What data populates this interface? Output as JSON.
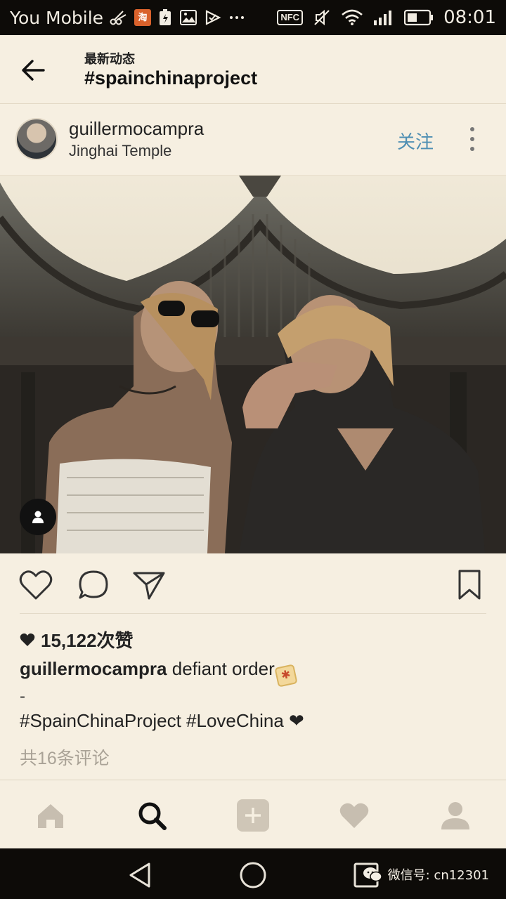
{
  "status_bar": {
    "carrier": "You Mobile",
    "nfc": "NFC",
    "tao_icon_label": "淘",
    "time": "08:01"
  },
  "header": {
    "subtitle": "最新动态",
    "title": "#spainchinaproject"
  },
  "post": {
    "username": "guillermocampra",
    "location": "Jinghai Temple",
    "follow_label": "关注",
    "likes": "15,122次赞",
    "caption_user": "guillermocampra",
    "caption_text": "defiant order",
    "caption_dash": "-",
    "hashtags": "#SpainChinaProject #LoveChina ❤",
    "comments_link": "共16条评论"
  },
  "watermark": {
    "text": "微信号: cn12301"
  },
  "icons": {
    "back": "arrow-left-icon",
    "more": "more-vertical-icon",
    "like": "heart-outline-icon",
    "comment": "comment-bubble-icon",
    "share": "paper-plane-icon",
    "save": "bookmark-icon",
    "tag": "person-tag-icon",
    "home": "home-icon",
    "search": "search-icon",
    "add": "plus-square-icon",
    "activity": "heart-icon",
    "profile": "profile-icon"
  },
  "colors": {
    "background": "#f6efe1",
    "follow": "#4f8fb3",
    "status_bar": "#0d0b08",
    "muted_text": "#a9a296"
  }
}
